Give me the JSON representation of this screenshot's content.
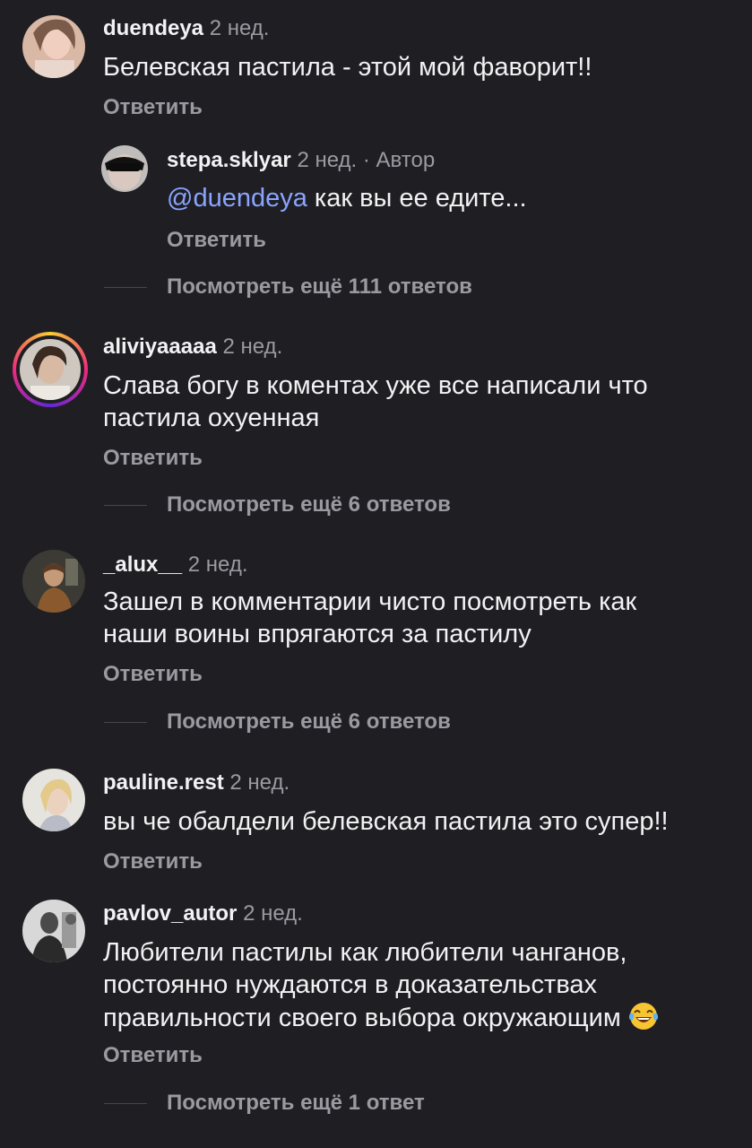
{
  "comments": [
    {
      "username": "duendeya",
      "time": "2 нед.",
      "text": "Белевская пастила - этой мой фаворит!!",
      "reply_label": "Ответить",
      "replies": [
        {
          "username": "stepa.sklyar",
          "time": "2 нед.",
          "author_tag": "· Автор",
          "mention": "@duendeya",
          "text": " как вы ее едите...",
          "reply_label": "Ответить"
        }
      ],
      "more_replies": "Посмотреть ещё 111 ответов"
    },
    {
      "username": "aliviyaaaaa",
      "time": "2 нед.",
      "text_lines": [
        "Слава богу в коментах уже все написали что",
        "пастила охуенная"
      ],
      "reply_label": "Ответить",
      "more_replies": "Посмотреть ещё 6 ответов"
    },
    {
      "username": "_alux__",
      "time": "2 нед.",
      "text_lines": [
        "Зашел в комментарии чисто посмотреть как",
        "наши воины впрягаются за пастилу"
      ],
      "reply_label": "Ответить",
      "more_replies": "Посмотреть ещё 6 ответов"
    },
    {
      "username": "pauline.rest",
      "time": "2 нед.",
      "text": "вы че обалдели белевская пастила это супер!!",
      "reply_label": "Ответить"
    },
    {
      "username": "pavlov_autor",
      "time": "2 нед.",
      "text_lines": [
        "Любители пастилы как любители чанганов,",
        "постоянно нуждаются в доказательствах",
        "правильности своего выбора окружающим"
      ],
      "emoji": "face-with-tears-of-joy-icon",
      "reply_label": "Ответить",
      "more_replies": "Посмотреть ещё 1 ответ"
    }
  ],
  "colors": {
    "background": "#1f1f23",
    "text": "#f2f2f4",
    "secondary": "#9a9aa0",
    "mention": "#8aa4ff",
    "story_ring": [
      "#f9ce34",
      "#ee2a7b",
      "#6228d7"
    ]
  }
}
